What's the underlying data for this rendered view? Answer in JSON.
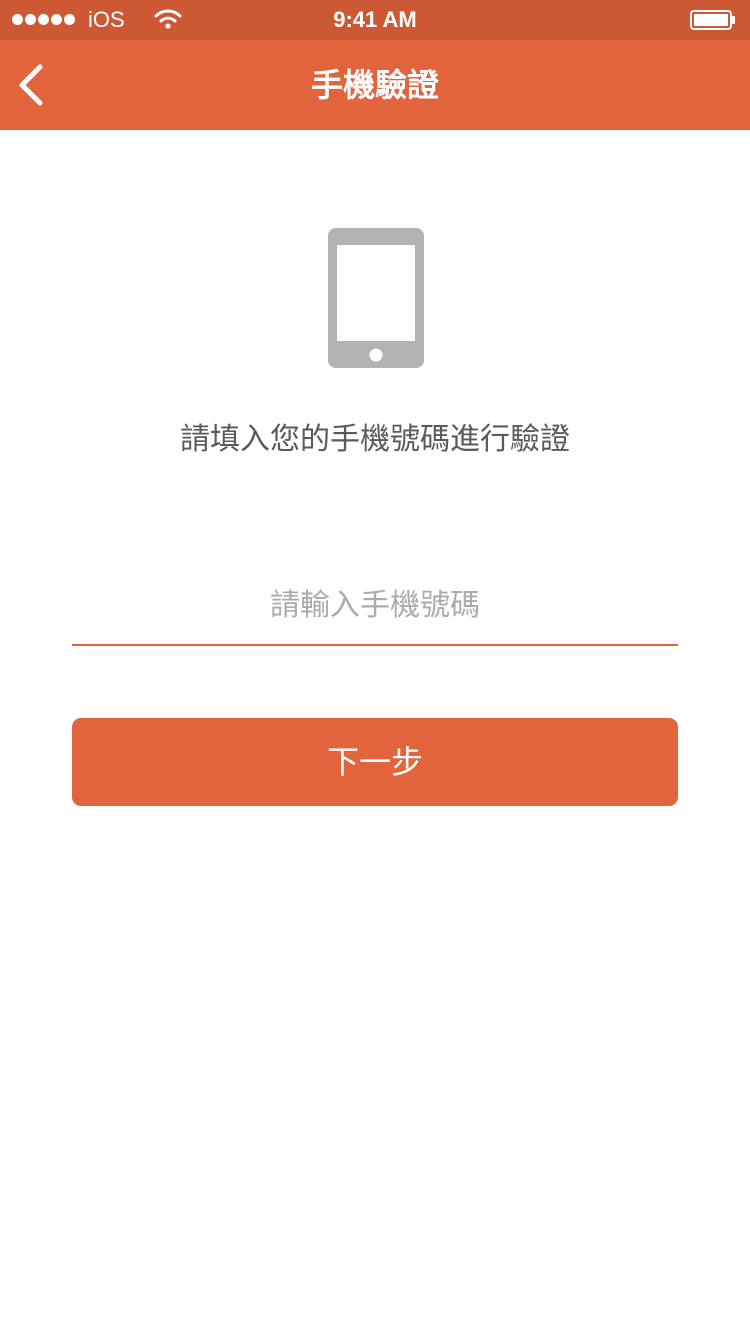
{
  "status_bar": {
    "carrier": "iOS",
    "time": "9:41 AM",
    "signal_icon": "signal-dots-icon",
    "wifi_icon": "wifi-icon",
    "battery_icon": "battery-icon"
  },
  "nav": {
    "title": "手機驗證",
    "back_icon": "chevron-left-icon"
  },
  "main": {
    "illustration_icon": "smartphone-icon",
    "instruction": "請填入您的手機號碼進行驗證",
    "phone_input": {
      "placeholder": "請輸入手機號碼",
      "value": ""
    },
    "next_button_label": "下一步"
  },
  "colors": {
    "status_bar": "#cd5934",
    "accent": "#e1643c",
    "icon_gray": "#b3b3b3",
    "instruction_text": "#5a5a5a",
    "placeholder_text": "#ababab"
  }
}
